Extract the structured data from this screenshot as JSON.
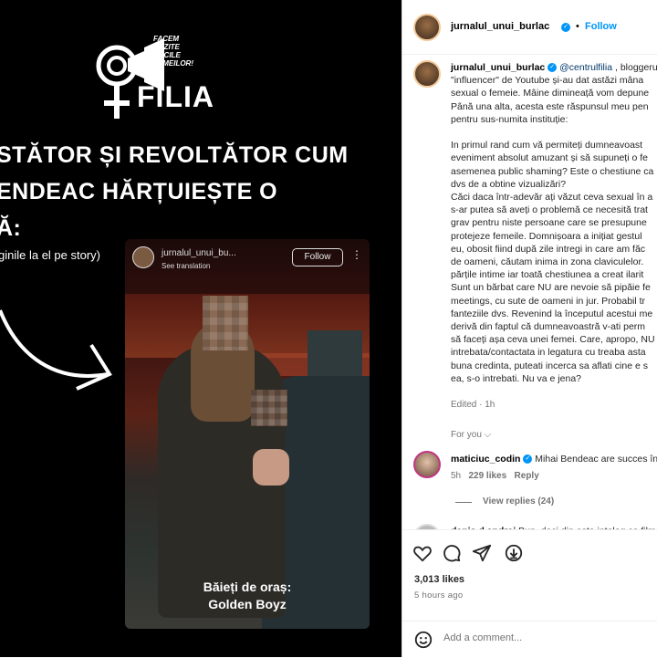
{
  "post_media": {
    "logo_tagline": [
      "FACEM",
      "AUZITE",
      "VOCILE",
      "FEMEILOR!"
    ],
    "logo_brand": "FILIA",
    "headline": [
      "STĂTOR ȘI REVOLTĂTOR CUM",
      "ENDEAC HĂRȚUIEȘTE O",
      "Ă:"
    ],
    "subcaption": "ginile la el pe story)",
    "story": {
      "username": "jurnalul_unui_bu...",
      "translate": "See translation",
      "follow": "Follow",
      "caption_line1": "Băieți de oraș:",
      "caption_line2": "Golden Boyz"
    }
  },
  "side": {
    "header": {
      "username": "jurnalul_unui_burlac",
      "separator": "•",
      "follow": "Follow"
    },
    "caption": {
      "username": "jurnalul_unui_burlac",
      "mention": "@centrulfilia",
      "text": " , bloggeru\n\"influencer\" de Youtube și-au dat astăzi mâna\nsexual o femeie. Mâine dimineață vom depune\nPână una alta, acesta este răspunsul meu pen\npentru sus-numita instituție:\n\nIn primul rand cum vă permiteți dumneavoast\neveniment absolut amuzant și să supuneți o fe\nasemenea public shaming? Este o chestiune ca\ndvs de a obtine vizualizări?\nCăci daca într-adevăr ați văzut ceva sexual în a\ns-ar putea să aveți o problemă ce necesită trat\ngrav pentru niste persoane care se presupune\nprotejeze femeile. Domnișoara a inițiat gestul\neu, obosit fiind după zile intregi in care am făc\nde oameni, căutam inima in zona claviculelor.\npărțile intime iar toată chestiunea a creat ilarit\nSunt un bărbat care NU are nevoie să pipăie fe\nmeetings, cu sute de oameni in jur. Probabil tr\nfanteziile dvs. Revenind la începutul acestui me\nderivă din faptul că dumneavoastră v-ati perm\nsă faceți așa ceva unei femei. Care, apropo, NU\nintrebata/contactata in legatura cu treaba asta\nbuna credinta, puteati incerca sa aflati cine e s\nea, s-o intrebati. Nu va e jena?",
      "edited": "Edited · 1h"
    },
    "for_you": "For you ⌵",
    "comments": [
      {
        "username": "maticiuc_codin",
        "text": "Mihai Bendeac are succes în",
        "time": "5h",
        "likes": "229 likes",
        "reply": "Reply"
      },
      {
        "username": "denis.d.andrei",
        "text": "Bun, deci din asta inteleg ca film"
      }
    ],
    "view_replies": "View replies (24)",
    "likes": "3,013 likes",
    "time_ago": "5 hours ago",
    "add_comment_placeholder": "Add a comment..."
  }
}
